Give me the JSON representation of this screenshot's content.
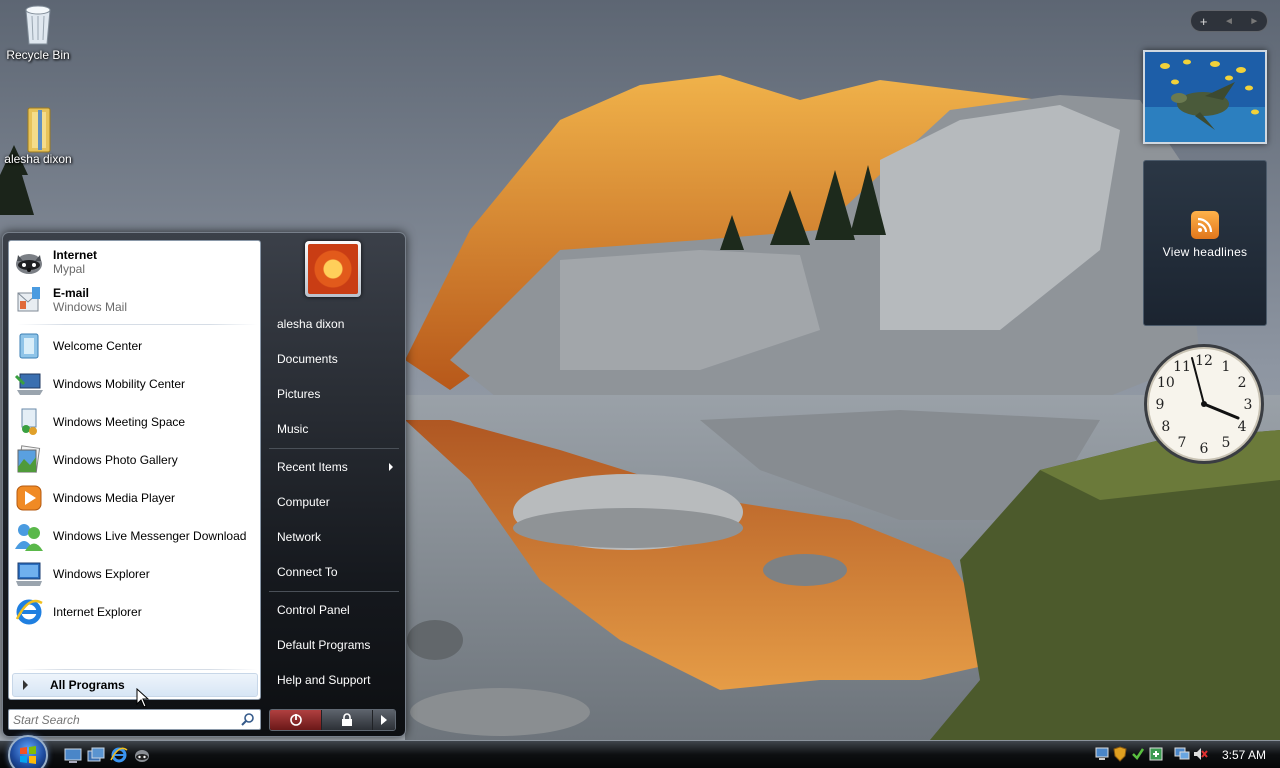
{
  "desktop": {
    "icons": [
      {
        "label": "Recycle Bin",
        "icon": "recycle-bin-icon"
      },
      {
        "label": "alesha dixon",
        "icon": "user-folder-icon"
      }
    ]
  },
  "sidebar": {
    "controls": {
      "add": "+",
      "prev": "◄",
      "next": "►"
    },
    "feed_gadget": {
      "label": "View headlines",
      "icon": "rss-feed-icon"
    },
    "clock_gadget": {
      "numbers": [
        "12",
        "1",
        "2",
        "3",
        "4",
        "5",
        "6",
        "7",
        "8",
        "9",
        "10",
        "11"
      ],
      "time": "3:57"
    }
  },
  "start_menu": {
    "pinned": [
      {
        "title": "Internet",
        "subtitle": "Mypal",
        "icon": "mypal-raccoon-icon"
      },
      {
        "title": "E-mail",
        "subtitle": "Windows Mail",
        "icon": "windows-mail-icon"
      }
    ],
    "recent": [
      {
        "label": "Welcome Center",
        "icon": "welcome-center-icon"
      },
      {
        "label": "Windows Mobility Center",
        "icon": "mobility-center-icon"
      },
      {
        "label": "Windows Meeting Space",
        "icon": "meeting-space-icon"
      },
      {
        "label": "Windows Photo Gallery",
        "icon": "photo-gallery-icon"
      },
      {
        "label": "Windows Media Player",
        "icon": "media-player-icon"
      },
      {
        "label": "Windows Live Messenger Download",
        "icon": "messenger-icon"
      },
      {
        "label": "Windows Explorer",
        "icon": "explorer-icon"
      },
      {
        "label": "Internet Explorer",
        "icon": "internet-explorer-icon"
      }
    ],
    "all_programs": "All Programs",
    "search_placeholder": "Start Search",
    "right_items": {
      "user": "alesha dixon",
      "documents": "Documents",
      "pictures": "Pictures",
      "music": "Music",
      "recent_items": "Recent Items",
      "computer": "Computer",
      "network": "Network",
      "connect_to": "Connect To",
      "control_panel": "Control Panel",
      "default_programs": "Default Programs",
      "help_support": "Help and Support"
    }
  },
  "taskbar": {
    "quick_launch": [
      "show-desktop-icon",
      "switch-windows-icon",
      "internet-explorer-icon",
      "mypal-icon"
    ],
    "tray_icons": [
      "network-status-icon",
      "security-shield-icon",
      "update-icon",
      "defender-icon",
      "display-icon",
      "volume-muted-icon"
    ],
    "clock": "3:57 AM"
  },
  "colors": {
    "taskbar": "#0d0f11",
    "start_menu_dark": "#15181d",
    "feed_orange": "#e0761c"
  }
}
